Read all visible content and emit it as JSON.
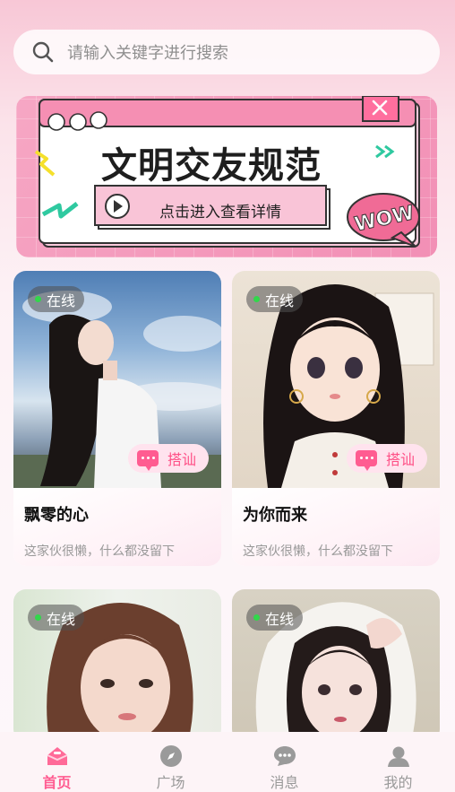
{
  "search": {
    "placeholder": "请输入关键字进行搜索",
    "icon": "search-icon"
  },
  "banner": {
    "title": "文明交友规范",
    "subtitle": "点击进入查看详情",
    "sticker": "WOW"
  },
  "users": [
    {
      "name": "飘零的心",
      "bio": "这家伙很懒，什么都没留下",
      "status": "在线",
      "action": "搭讪"
    },
    {
      "name": "为你而来",
      "bio": "这家伙很懒，什么都没留下",
      "status": "在线",
      "action": "搭讪"
    },
    {
      "name": "",
      "bio": "",
      "status": "在线",
      "action": ""
    },
    {
      "name": "",
      "bio": "",
      "status": "在线",
      "action": ""
    }
  ],
  "tabbar": {
    "items": [
      {
        "label": "首页",
        "icon": "home-icon",
        "active": true
      },
      {
        "label": "广场",
        "icon": "compass-icon",
        "active": false
      },
      {
        "label": "消息",
        "icon": "chat-icon",
        "active": false
      },
      {
        "label": "我的",
        "icon": "profile-icon",
        "active": false
      }
    ]
  },
  "colors": {
    "accent": "#ff5c91",
    "online": "#32d74b"
  }
}
